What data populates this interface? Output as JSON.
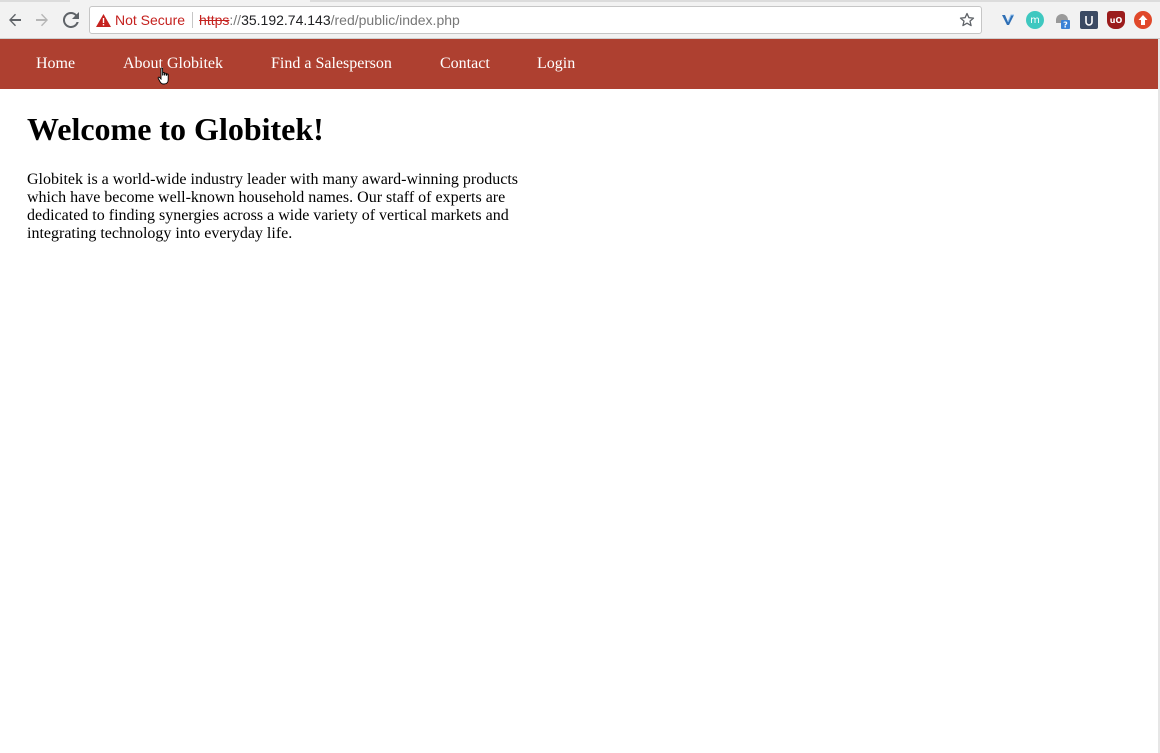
{
  "browser": {
    "security_label": "Not Secure",
    "url_scheme": "https",
    "url_separator": "://",
    "url_host": "35.192.74.143",
    "url_path": "/red/public/index.php",
    "extensions": [
      {
        "name": "vivaldi-extension-icon",
        "glyph": "V"
      },
      {
        "name": "m-extension-icon",
        "glyph": "m"
      },
      {
        "name": "incognito-extension-icon",
        "glyph": "?"
      },
      {
        "name": "square-extension-icon",
        "glyph": "u"
      },
      {
        "name": "ublock-extension-icon",
        "glyph": "uO"
      },
      {
        "name": "upload-extension-icon",
        "glyph": "⬆"
      }
    ]
  },
  "site": {
    "nav_color": "#ae4030",
    "nav_items": [
      {
        "label": "Home"
      },
      {
        "label": "About Globitek"
      },
      {
        "label": "Find a Salesperson"
      },
      {
        "label": "Contact"
      },
      {
        "label": "Login"
      }
    ],
    "heading": "Welcome to Globitek!",
    "intro": "Globitek is a world-wide industry leader with many award-winning products which have become well-known household names. Our staff of experts are dedicated to finding synergies across a wide variety of vertical markets and integrating technology into everyday life."
  }
}
